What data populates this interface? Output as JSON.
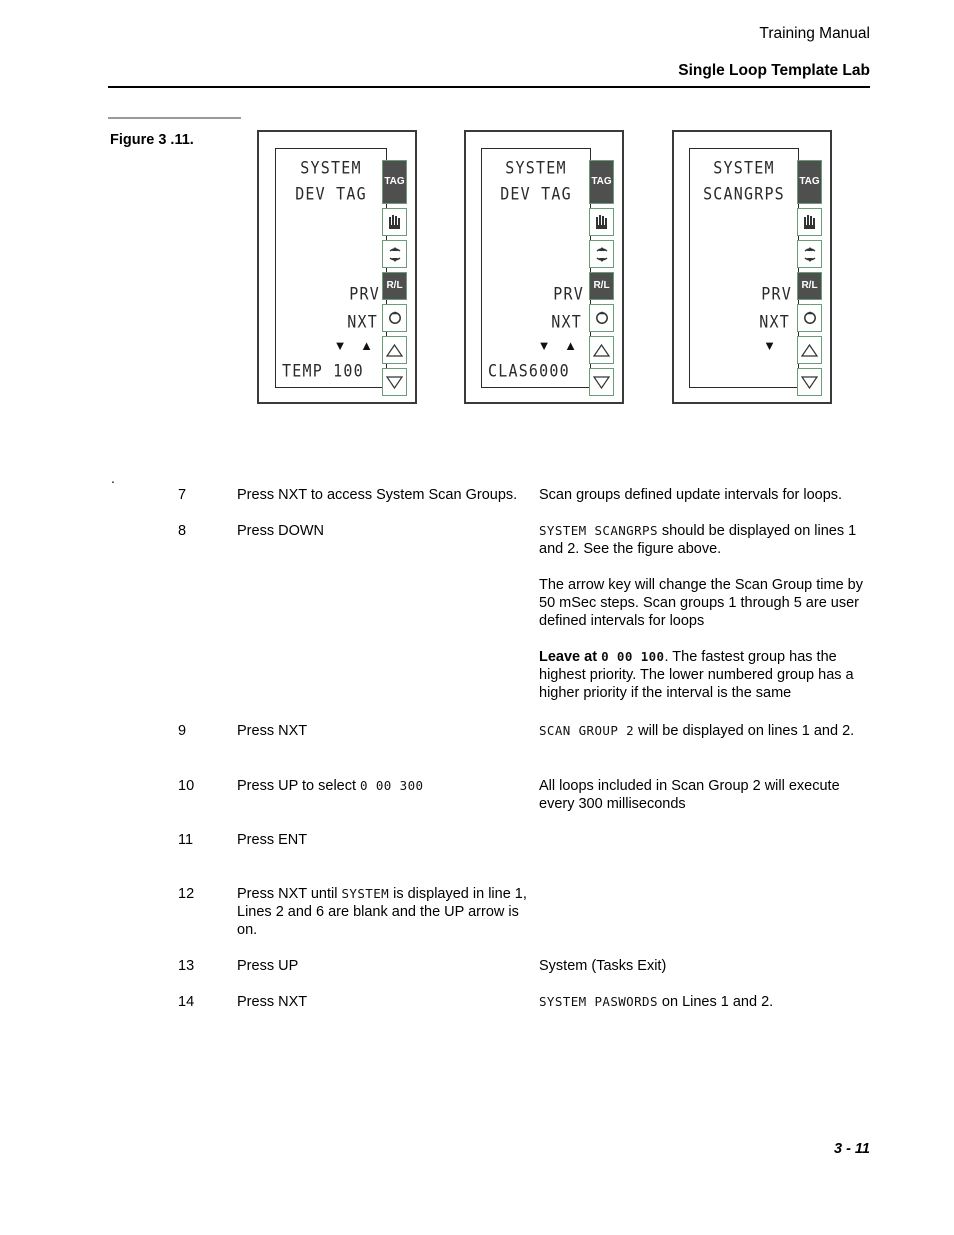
{
  "page": {
    "header_title": "Training Manual",
    "header_subtitle": "Single Loop Template Lab",
    "footer_page": "3 - 11"
  },
  "figure": {
    "caption": "Figure 3 .11.",
    "devices": [
      {
        "line1": "SYSTEM",
        "line2": "DEV TAG",
        "prv": "PRV",
        "nxt": "NXT",
        "arrows": "▼ ▲",
        "bottom": "TEMP 100"
      },
      {
        "line1": "SYSTEM",
        "line2": "DEV TAG",
        "prv": "PRV",
        "nxt": "NXT",
        "arrows": "▼ ▲",
        "bottom": "CLAS6000"
      },
      {
        "line1": "SYSTEM",
        "line2": "SCANGRPS",
        "prv": "PRV",
        "nxt": "NXT",
        "arrows": "▼",
        "bottom": ""
      }
    ],
    "buttons": [
      {
        "name": "tag-button",
        "label": "TAG",
        "icon": "tag-label"
      },
      {
        "name": "hand-button",
        "label": "",
        "icon": "hand-icon"
      },
      {
        "name": "updown-arrow-button",
        "label": "",
        "icon": "up-down-arrow-icon"
      },
      {
        "name": "remote-local-button",
        "label": "R/L",
        "icon": "remote-local-label"
      },
      {
        "name": "rotate-button",
        "label": "",
        "icon": "circular-arrow-icon"
      },
      {
        "name": "up-arrow-button",
        "label": "",
        "icon": "up-triangle-icon"
      },
      {
        "name": "down-arrow-button",
        "label": "",
        "icon": "down-triangle-icon"
      }
    ]
  },
  "body": {
    "stray_mark": ".",
    "steps": [
      {
        "number": "7",
        "action": "Press NXT to access System Scan Groups.",
        "result": "Scan groups defined update intervals for loops."
      },
      {
        "number": "8",
        "action": "Press DOWN",
        "result_lcd": "SYSTEM SCANGRPS",
        "result_tail": " should be displayed on lines 1 and 2. See the figure above.",
        "extra_paragraphs": [
          "The arrow key will change the Scan Group time by 50 mSec steps. Scan groups 1 through 5 are user defined intervals for loops"
        ],
        "leave_at_label": "Leave at ",
        "leave_at_lcd": "0 00 100",
        "leave_at_tail": ". The fastest group has the highest priority. The lower numbered group has a higher priority if the interval is the same"
      },
      {
        "number": "9",
        "action": "Press NXT",
        "result_lcd": "SCAN GROUP 2",
        "result_tail": " will be displayed on lines 1 and 2."
      },
      {
        "number": "10",
        "action_pre": "Press UP to select ",
        "action_lcd": "0 00 300",
        "result": "All loops included in Scan Group 2 will execute every 300 milliseconds"
      },
      {
        "number": "11",
        "action": "Press ENT",
        "result": ""
      },
      {
        "number": "12",
        "action_pre": "Press NXT until ",
        "action_lcd": "SYSTEM",
        "action_tail": " is displayed in line 1, Lines 2 and 6 are blank and the UP arrow is on.",
        "result": ""
      },
      {
        "number": "13",
        "action": "Press UP",
        "result": "System (Tasks Exit)"
      },
      {
        "number": "14",
        "action": "Press NXT",
        "result_lcd": "SYSTEM PASWORDS",
        "result_tail": " on Lines 1 and 2."
      }
    ]
  }
}
